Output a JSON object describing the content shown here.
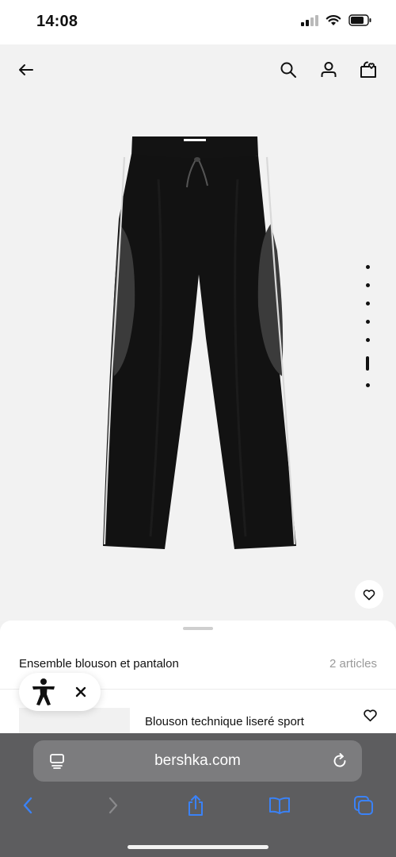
{
  "status_bar": {
    "time": "14:08",
    "icons": [
      "cellular-signal-icon",
      "wifi-icon",
      "battery-icon"
    ]
  },
  "nav": {
    "icons": [
      "back-arrow-icon",
      "search-icon",
      "user-icon",
      "wishlist-bag-icon"
    ]
  },
  "product": {
    "image": "black-wide-leg-track-pants-with-white-side-piping",
    "carousel": {
      "total": 7,
      "active_index": 6
    }
  },
  "sheet": {
    "title": "Ensemble blouson et pantalon",
    "count": "2 articles",
    "items": [
      {
        "name": "Blouson technique liseré sport"
      }
    ]
  },
  "accessibility": {
    "icons": [
      "accessibility-person-icon",
      "close-icon"
    ]
  },
  "browser": {
    "url": "bershka.com",
    "toolbar": [
      "back-chevron-icon",
      "forward-chevron-icon",
      "share-icon",
      "bookmarks-icon",
      "tabs-icon"
    ],
    "accent_color": "#3a82f7"
  },
  "colors": {
    "background": "#f2f2f2",
    "text": "#111111",
    "muted": "#9a9a9a",
    "browser_bar": "#5d5d5f"
  }
}
